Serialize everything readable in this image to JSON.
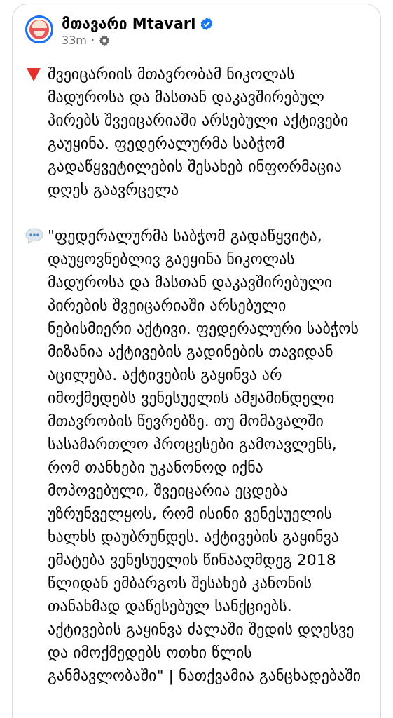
{
  "post": {
    "page_name": "მთავარი Mtavari",
    "verified": true,
    "time": "33m",
    "separator": "·",
    "paragraphs": [
      {
        "kind": "alert",
        "text": "შვეიცარიის მთავრობამ ნიკოლას მადუროსა და მასთან დაკავშირებულ პირებს შვეიცარიაში არსებული აქტივები გაუყინა. ფედერალურმა საბჭომ გადაწყვეტილების შესახებ ინფორმაცია დღეს გაავრცელა"
      },
      {
        "kind": "quote",
        "text": "\"ფედერალურმა საბჭომ გადაწყვიტა, დაუყოვნებლივ გაეყინა ნიკოლას მადუროსა და მასთან დაკავშირებული პირების შვეიცარიაში არსებული ნებისმიერი აქტივი. ფედერალური საბჭოს მიზანია აქტივების გადინების თავიდან აცილება. აქტივების გაყინვა არ იმოქმედებს ვენესუელის ამჟამინდელი მთავრობის წევრებზე. თუ მომავალში სასამართლო პროცესები გამოავლენს, რომ თანხები უკანონოდ იქნა მოპოვებული, შვეიცარია ეცდება უზრუნველყოს, რომ ისინი ვენესუელის ხალხს დაუბრუნდეს. აქტივების გაყინვა ემატება ვენესუელის წინააღმდეგ 2018 წლიდან ემბარგოს შესახებ კანონის თანახმად დაწესებულ სანქციებს. აქტივების გაყინვა ძალაში შედის დღესვე და იმოქმედებს ოთხი წლის განმავლობაში\" | ნათქვამია განცხადებაში"
      }
    ]
  }
}
